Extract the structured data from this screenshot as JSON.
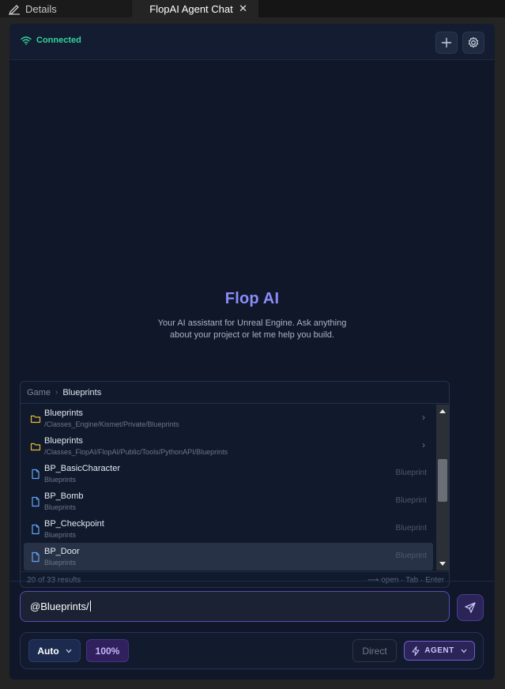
{
  "tabs": {
    "details": "Details",
    "chat": "FlopAI Agent Chat",
    "close_glyph": "✕"
  },
  "header": {
    "status": "Connected"
  },
  "welcome": {
    "title": "Flop AI",
    "subtitle": "Your AI assistant for Unreal Engine. Ask anything about your project or let me help you build."
  },
  "popup": {
    "breadcrumb": [
      "Game",
      "Blueprints"
    ],
    "items": [
      {
        "name": "Blueprints",
        "path": "/Classes_Engine/Kismet/Private/Blueprints",
        "type": "",
        "kind": "folder"
      },
      {
        "name": "Blueprints",
        "path": "/Classes_FlopAI/FlopAI/Public/Tools/PythonAPI/Blueprints",
        "type": "",
        "kind": "folder"
      },
      {
        "name": "BP_BasicCharacter",
        "path": "Blueprints",
        "type": "Blueprint",
        "kind": "file"
      },
      {
        "name": "BP_Bomb",
        "path": "Blueprints",
        "type": "Blueprint",
        "kind": "file"
      },
      {
        "name": "BP_Checkpoint",
        "path": "Blueprints",
        "type": "Blueprint",
        "kind": "file"
      },
      {
        "name": "BP_Door",
        "path": "Blueprints",
        "type": "Blueprint",
        "kind": "file"
      }
    ],
    "selected_index": 5,
    "count": "20 of 33 results",
    "hint": "⟶ open · Tab · Enter"
  },
  "input": {
    "value": "@Blueprints/"
  },
  "toolbar": {
    "mode": "Auto",
    "zoom": "100%",
    "direct": "Direct",
    "agent": "AGENT"
  },
  "colors": {
    "accent": "#8b8cf8",
    "connected": "#34d399",
    "background": "#0f1729"
  }
}
